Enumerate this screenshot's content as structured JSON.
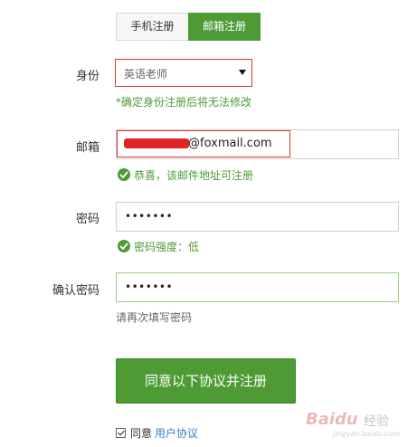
{
  "tabs": [
    {
      "label": "手机注册",
      "active": false
    },
    {
      "label": "邮箱注册",
      "active": true
    }
  ],
  "identity": {
    "label": "身份",
    "selected": "英语老师",
    "hint": "*确定身份注册后将无法修改"
  },
  "email": {
    "label": "邮箱",
    "value": "@foxmail.com",
    "status": "恭喜，该邮件地址可注册"
  },
  "password": {
    "label": "密码",
    "value": "•••••••",
    "status": "密码强度：低"
  },
  "confirm_password": {
    "label": "确认密码",
    "value": "•••••••",
    "hint": "请再次填写密码"
  },
  "submit": {
    "label": "同意以下协议并注册"
  },
  "agreement": {
    "checked": true,
    "prefix": "同意",
    "link": "用户协议"
  },
  "watermark": {
    "brand": "Baidu",
    "suffix": "经验",
    "url": "jingyan.baidu.com"
  },
  "colors": {
    "accent": "#4e9b35",
    "highlight": "#e0343b",
    "link": "#3b7fc4"
  }
}
